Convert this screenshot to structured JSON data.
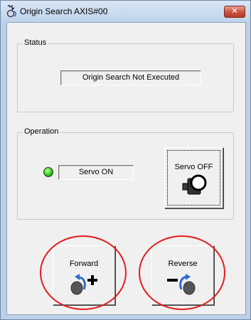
{
  "window": {
    "title": "Origin Search AXIS#00",
    "close_symbol": "✕"
  },
  "status_group": {
    "label": "Status",
    "status_text": "Origin Search Not Executed"
  },
  "operation_group": {
    "label": "Operation",
    "servo_state_text": "Servo ON",
    "servo_button_label": "Servo OFF",
    "led_color": "#2ec41a"
  },
  "jog": {
    "forward_label": "Forward",
    "reverse_label": "Reverse",
    "highlight_color": "#e51b1b"
  },
  "icons": {
    "app": "servo-motor-icon",
    "servo": "servo-motor-icon",
    "forward": "forward-rotation-plus-icon",
    "reverse": "reverse-rotation-minus-icon"
  }
}
